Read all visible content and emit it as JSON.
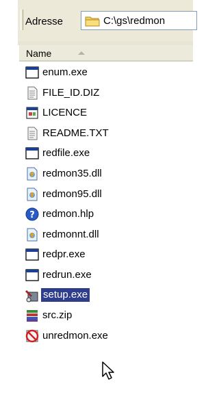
{
  "address_bar": {
    "label": "Adresse",
    "path": "C:\\gs\\redmon"
  },
  "file_list": {
    "column_name": "Name",
    "items": [
      {
        "name": "enum.exe",
        "icon": "exe-window-icon"
      },
      {
        "name": "FILE_ID.DIZ",
        "icon": "text-document-icon"
      },
      {
        "name": "LICENCE",
        "icon": "generic-file-icon"
      },
      {
        "name": "README.TXT",
        "icon": "text-document-icon"
      },
      {
        "name": "redfile.exe",
        "icon": "exe-window-icon"
      },
      {
        "name": "redmon35.dll",
        "icon": "dll-icon"
      },
      {
        "name": "redmon95.dll",
        "icon": "dll-icon"
      },
      {
        "name": "redmon.hlp",
        "icon": "help-icon"
      },
      {
        "name": "redmonnt.dll",
        "icon": "dll-icon"
      },
      {
        "name": "redpr.exe",
        "icon": "exe-window-icon"
      },
      {
        "name": "redrun.exe",
        "icon": "exe-window-icon"
      },
      {
        "name": "setup.exe",
        "icon": "setup-icon",
        "selected": true
      },
      {
        "name": "src.zip",
        "icon": "zip-archive-icon"
      },
      {
        "name": "unredmon.exe",
        "icon": "uninstall-icon"
      }
    ]
  },
  "colors": {
    "selection": "#2f3e8c",
    "toolbar": "#ece9d8",
    "header": "#ebeadb"
  }
}
